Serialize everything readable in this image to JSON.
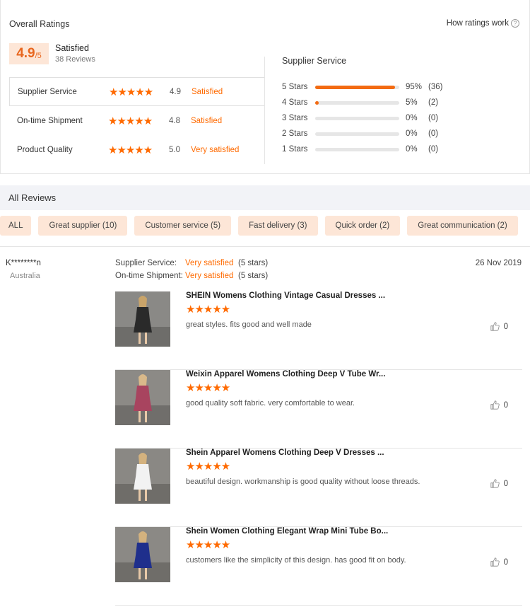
{
  "overall": {
    "title": "Overall Ratings",
    "how_link": "How ratings work",
    "score": "4.9",
    "score_den": "/5",
    "summary_label": "Satisfied",
    "review_count": "38 Reviews"
  },
  "categories": [
    {
      "name": "Supplier Service",
      "stars": "★★★★★",
      "score": "4.9",
      "label": "Satisfied"
    },
    {
      "name": "On-time Shipment",
      "stars": "★★★★★",
      "score": "4.8",
      "label": "Satisfied"
    },
    {
      "name": "Product Quality",
      "stars": "★★★★★",
      "score": "5.0",
      "label": "Very satisfied"
    }
  ],
  "distribution": {
    "title": "Supplier Service",
    "rows": [
      {
        "stars": "5 Stars",
        "percent_value": 95,
        "pct": "95%",
        "count": "(36)"
      },
      {
        "stars": "4 Stars",
        "percent_value": 5,
        "pct": "5%",
        "count": "(2)"
      },
      {
        "stars": "3 Stars",
        "percent_value": 0,
        "pct": "0%",
        "count": "(0)"
      },
      {
        "stars": "2 Stars",
        "percent_value": 0,
        "pct": "0%",
        "count": "(0)"
      },
      {
        "stars": "1 Stars",
        "percent_value": 0,
        "pct": "0%",
        "count": "(0)"
      }
    ]
  },
  "all_reviews": {
    "title": "All Reviews",
    "filters": [
      "ALL",
      "Great supplier (10)",
      "Customer service (5)",
      "Fast delivery (3)",
      "Quick order (2)",
      "Great communication (2)"
    ]
  },
  "review": {
    "name": "K********n",
    "country": "Australia",
    "date": "26 Nov 2019",
    "service_lines": [
      {
        "label": "Supplier Service:",
        "value": "Very satisfied",
        "stars": "(5 stars)"
      },
      {
        "label": "On-time Shipment:",
        "value": "Very satisfied",
        "stars": "(5 stars)"
      }
    ],
    "products": [
      {
        "title": "SHEIN Womens Clothing Vintage Casual Dresses ...",
        "stars": "★★★★★",
        "comment": "great styles. fits good and well made",
        "likes": "0",
        "dress_color": "#2a2a2a"
      },
      {
        "title": "Weixin Apparel Womens Clothing Deep V Tube Wr...",
        "stars": "★★★★★",
        "comment": "good quality soft fabric. very comfortable to wear.",
        "likes": "0",
        "dress_color": "#a8445f"
      },
      {
        "title": "Shein Apparel Womens Clothing Deep V Dresses ...",
        "stars": "★★★★★",
        "comment": "beautiful design. workmanship is good quality without loose threads.",
        "likes": "0",
        "dress_color": "#f2f2f2"
      },
      {
        "title": "Shein Women Clothing Elegant Wrap Mini Tube Bo...",
        "stars": "★★★★★",
        "comment": "customers like the simplicity of this design. has good fit on body.",
        "likes": "0",
        "dress_color": "#1f2f8c"
      }
    ]
  },
  "colors": {
    "accent": "#ff6a00",
    "chip_bg": "#fde6d7",
    "bar": "#f36b12"
  }
}
